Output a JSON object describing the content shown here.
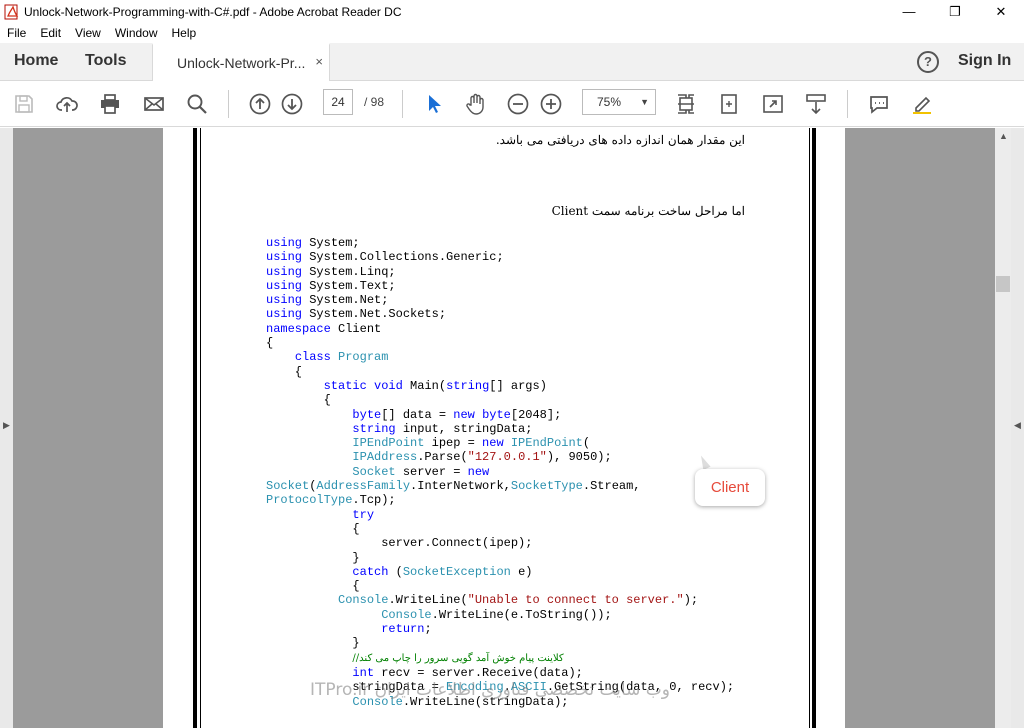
{
  "window": {
    "title": "Unlock-Network-Programming-with-C#.pdf - Adobe Acrobat Reader DC",
    "minimize": "—",
    "restore": "❐",
    "close": "✕"
  },
  "menu": [
    "File",
    "Edit",
    "View",
    "Window",
    "Help"
  ],
  "tabs": {
    "home": "Home",
    "tools": "Tools",
    "document": "Unlock-Network-Pr...",
    "close": "×",
    "help": "?",
    "sign_in": "Sign In"
  },
  "toolbar": {
    "page_current": "24",
    "page_total": "/ 98",
    "zoom": "75%"
  },
  "document": {
    "line1": "این مقدار همان اندازه داده های دریافتی می باشد.",
    "heading": "اما مراحل ساخت برنامه سمت Client",
    "callout": "Client",
    "watermark": "وب سایت تخصصی فناوری اطلاعات ایران ITPro.ir"
  },
  "code_lines": [
    [
      [
        "kw",
        "using"
      ],
      [
        "t",
        " System;"
      ]
    ],
    [
      [
        "kw",
        "using"
      ],
      [
        "t",
        " System.Collections.Generic;"
      ]
    ],
    [
      [
        "kw",
        "using"
      ],
      [
        "t",
        " System.Linq;"
      ]
    ],
    [
      [
        "kw",
        "using"
      ],
      [
        "t",
        " System.Text;"
      ]
    ],
    [
      [
        "kw",
        "using"
      ],
      [
        "t",
        " System.Net;"
      ]
    ],
    [
      [
        "kw",
        "using"
      ],
      [
        "t",
        " System.Net.Sockets;"
      ]
    ],
    [
      [
        "kw",
        "namespace"
      ],
      [
        "t",
        " Client"
      ]
    ],
    [
      [
        "t",
        "{"
      ]
    ],
    [
      [
        "t",
        "    "
      ],
      [
        "kw",
        "class"
      ],
      [
        "t",
        " "
      ],
      [
        "ty",
        "Program"
      ]
    ],
    [
      [
        "t",
        "    {"
      ]
    ],
    [
      [
        "t",
        "        "
      ],
      [
        "kw",
        "static"
      ],
      [
        "t",
        " "
      ],
      [
        "kw",
        "void"
      ],
      [
        "t",
        " Main("
      ],
      [
        "kw",
        "string"
      ],
      [
        "t",
        "[] args)"
      ]
    ],
    [
      [
        "t",
        "        {"
      ]
    ],
    [
      [
        "t",
        "            "
      ],
      [
        "kw",
        "byte"
      ],
      [
        "t",
        "[] data = "
      ],
      [
        "kw",
        "new"
      ],
      [
        "t",
        " "
      ],
      [
        "kw",
        "byte"
      ],
      [
        "t",
        "[2048];"
      ]
    ],
    [
      [
        "t",
        "            "
      ],
      [
        "kw",
        "string"
      ],
      [
        "t",
        " input, stringData;"
      ]
    ],
    [
      [
        "t",
        "            "
      ],
      [
        "ty",
        "IPEndPoint"
      ],
      [
        "t",
        " ipep = "
      ],
      [
        "kw",
        "new"
      ],
      [
        "t",
        " "
      ],
      [
        "ty",
        "IPEndPoint"
      ],
      [
        "t",
        "("
      ]
    ],
    [
      [
        "t",
        "            "
      ],
      [
        "ty",
        "IPAddress"
      ],
      [
        "t",
        ".Parse("
      ],
      [
        "str",
        "\"127.0.0.1\""
      ],
      [
        "t",
        "), 9050);"
      ]
    ],
    [
      [
        "t",
        "            "
      ],
      [
        "ty",
        "Socket"
      ],
      [
        "t",
        " server = "
      ],
      [
        "kw",
        "new"
      ]
    ],
    [
      [
        "ty",
        "Socket"
      ],
      [
        "t",
        "("
      ],
      [
        "ty",
        "AddressFamily"
      ],
      [
        "t",
        ".InterNetwork,"
      ],
      [
        "ty",
        "SocketType"
      ],
      [
        "t",
        ".Stream,"
      ]
    ],
    [
      [
        "ty",
        "ProtocolType"
      ],
      [
        "t",
        ".Tcp);"
      ]
    ],
    [
      [
        "t",
        "            "
      ],
      [
        "kw",
        "try"
      ]
    ],
    [
      [
        "t",
        "            {"
      ]
    ],
    [
      [
        "t",
        "                server.Connect(ipep);"
      ]
    ],
    [
      [
        "t",
        "            }"
      ]
    ],
    [
      [
        "t",
        "            "
      ],
      [
        "kw",
        "catch"
      ],
      [
        "t",
        " ("
      ],
      [
        "ty",
        "SocketException"
      ],
      [
        "t",
        " e)"
      ]
    ],
    [
      [
        "t",
        "            {"
      ]
    ],
    [
      [
        "t",
        "          "
      ],
      [
        "ty",
        "Console"
      ],
      [
        "t",
        ".WriteLine("
      ],
      [
        "str",
        "\"Unable to connect to server.\""
      ],
      [
        "t",
        ");"
      ]
    ],
    [
      [
        "t",
        "                "
      ],
      [
        "ty",
        "Console"
      ],
      [
        "t",
        ".WriteLine(e.ToString());"
      ]
    ],
    [
      [
        "t",
        "                "
      ],
      [
        "kw",
        "return"
      ],
      [
        "t",
        ";"
      ]
    ],
    [
      [
        "t",
        "            }"
      ]
    ],
    [
      [
        "t",
        "            "
      ],
      [
        "cm",
        "//کلاینت پیام خوش آمد گویی سرور را چاپ می کند"
      ]
    ],
    [
      [
        "t",
        "            "
      ],
      [
        "kw",
        "int"
      ],
      [
        "t",
        " recv = server.Receive(data);"
      ]
    ],
    [
      [
        "t",
        "            stringData = "
      ],
      [
        "ty",
        "Encoding"
      ],
      [
        "t",
        "."
      ],
      [
        "ty",
        "ASCII"
      ],
      [
        "t",
        ".GetString(data, 0, recv);"
      ]
    ],
    [
      [
        "t",
        "            "
      ],
      [
        "ty",
        "Console"
      ],
      [
        "t",
        ".WriteLine(stringData);"
      ]
    ]
  ]
}
